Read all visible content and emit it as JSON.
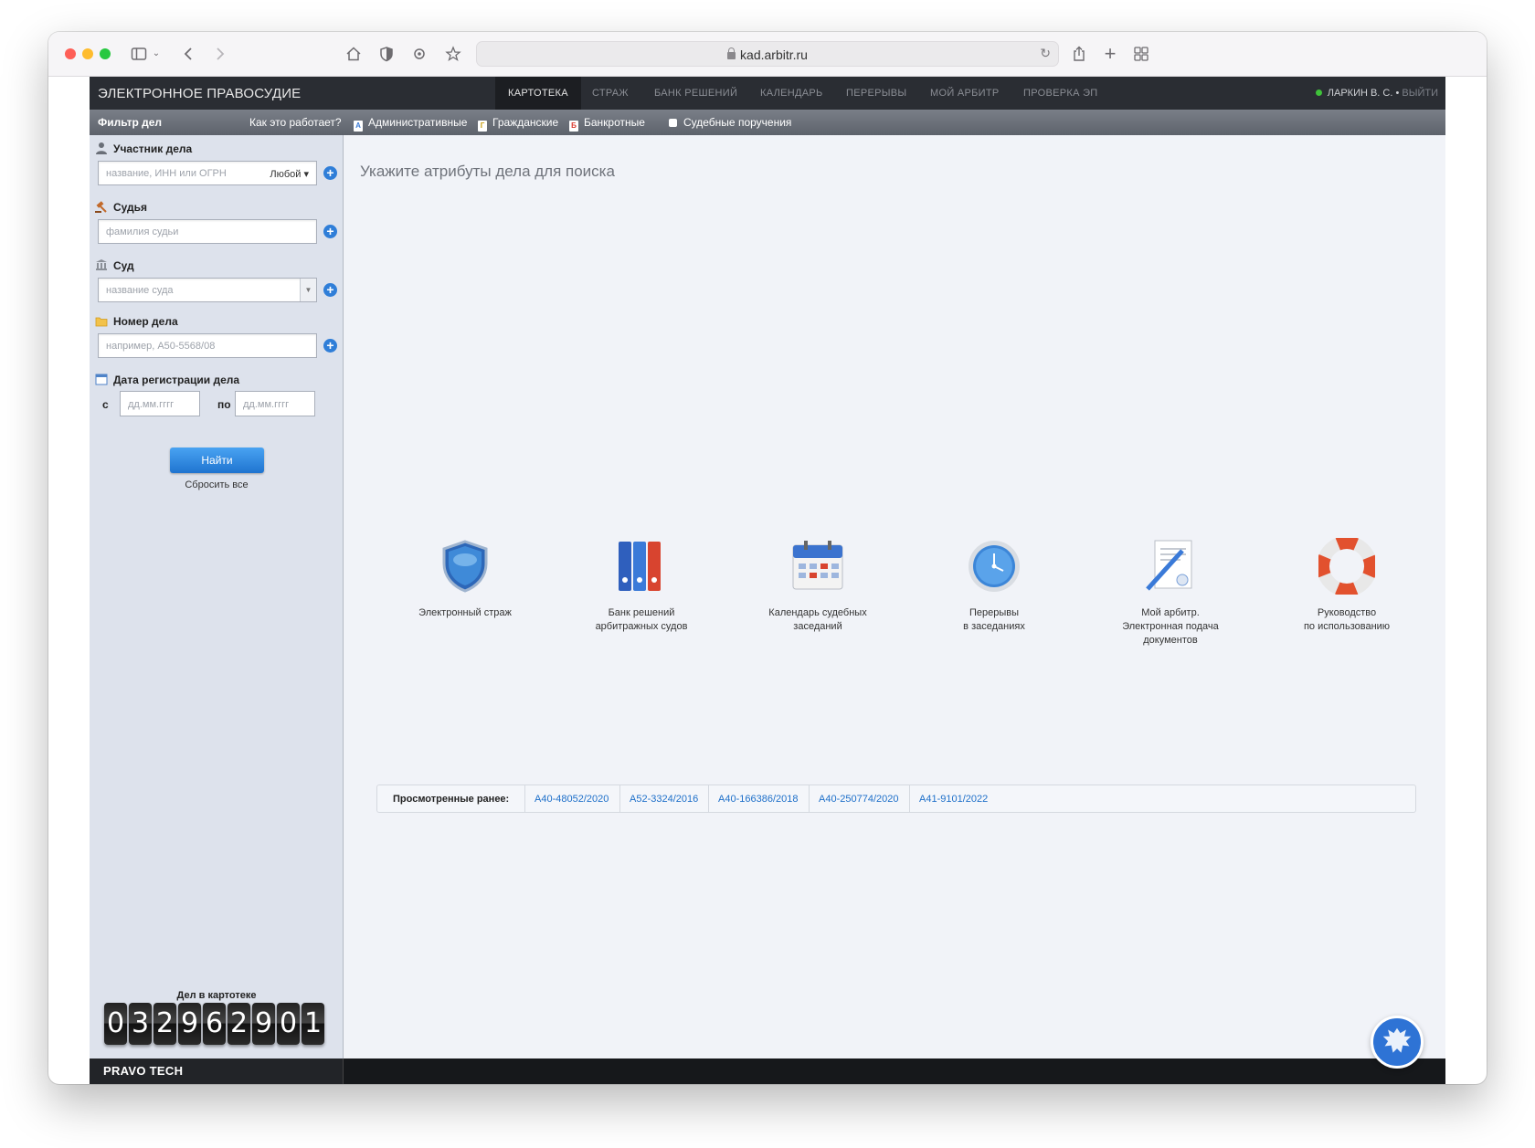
{
  "browser": {
    "url": "kad.arbitr.ru"
  },
  "site": {
    "brand": "ЭЛЕКТРОННОЕ ПРАВОСУДИЕ",
    "nav": [
      "КАРТОТЕКА",
      "СТРАЖ",
      "БАНК РЕШЕНИЙ",
      "КАЛЕНДАРЬ",
      "ПЕРЕРЫВЫ",
      "МОЙ АРБИТР",
      "ПРОВЕРКА ЭП"
    ],
    "active_nav": "КАРТОТЕКА",
    "user": "ЛАРКИН В. С.",
    "user_sep": " • ",
    "logout": "ВЫЙТИ"
  },
  "subnav": {
    "filter": "Фильтр дел",
    "how": "Как это работает?",
    "categories": [
      {
        "label": "Административные",
        "badge": "А",
        "color": "#3c7bd4"
      },
      {
        "label": "Гражданские",
        "badge": "Г",
        "color": "#f0c419"
      },
      {
        "label": "Банкротные",
        "badge": "Б",
        "color": "#d9362b"
      }
    ],
    "court_orders": "Судебные поручения"
  },
  "filter": {
    "participant_label": "Участник дела",
    "participant_placeholder": "название, ИНН или ОГРН",
    "participant_type": "Любой",
    "judge_label": "Судья",
    "judge_placeholder": "фамилия судьи",
    "court_label": "Суд",
    "court_placeholder": "название суда",
    "case_label": "Номер дела",
    "case_placeholder": "например, А50-5568/08",
    "date_label": "Дата регистрации дела",
    "from": "с",
    "to": "по",
    "date_placeholder": "дд.мм.гггг",
    "find": "Найти",
    "reset": "Сбросить все",
    "counter_title": "Дел в картотеке",
    "counter_digits": [
      "0",
      "3",
      "2",
      "9",
      "6",
      "2",
      "9",
      "0",
      "1"
    ]
  },
  "main": {
    "title": "Укажите атрибуты дела для поиска",
    "tiles": [
      {
        "icon": "shield-icon",
        "lines": [
          "Электронный страж"
        ]
      },
      {
        "icon": "binders-icon",
        "lines": [
          "Банк решений",
          "арбитражных судов"
        ]
      },
      {
        "icon": "calendar-icon",
        "lines": [
          "Календарь судебных",
          "заседаний"
        ]
      },
      {
        "icon": "clock-icon",
        "lines": [
          "Перерывы",
          "в заседаниях"
        ]
      },
      {
        "icon": "document-pen-icon",
        "lines": [
          "Мой арбитр.",
          "Электронная подача",
          "документов"
        ]
      },
      {
        "icon": "lifebuoy-icon",
        "lines": [
          "Руководство",
          "по использованию"
        ]
      }
    ],
    "history_title": "Просмотренные ранее:",
    "history": [
      "А40-48052/2020",
      "А52-3324/2016",
      "А40-166386/2018",
      "А40-250774/2020",
      "А41-9101/2022"
    ]
  },
  "footer": {
    "brand": "PRAVO TECH"
  }
}
